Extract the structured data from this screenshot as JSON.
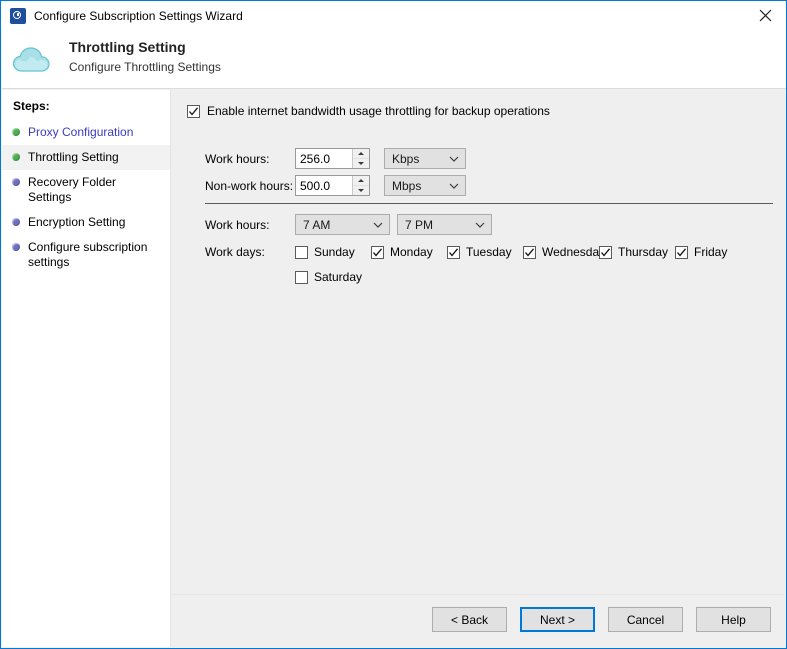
{
  "window": {
    "title": "Configure Subscription Settings Wizard",
    "app_icon": "clock-icon",
    "close_icon": "close-icon"
  },
  "header": {
    "icon": "cloud-icon",
    "title": "Throttling Setting",
    "subtitle": "Configure Throttling Settings"
  },
  "sidebar": {
    "label": "Steps:",
    "items": [
      {
        "label": "Proxy Configuration",
        "state": "done",
        "link": true,
        "active": false
      },
      {
        "label": "Throttling Setting",
        "state": "done",
        "link": false,
        "active": true
      },
      {
        "label": "Recovery Folder Settings",
        "state": "pending",
        "link": false,
        "active": false
      },
      {
        "label": "Encryption Setting",
        "state": "pending",
        "link": false,
        "active": false
      },
      {
        "label": "Configure subscription settings",
        "state": "pending",
        "link": false,
        "active": false
      }
    ]
  },
  "main": {
    "enable_throttling": {
      "label": "Enable internet bandwidth usage throttling for backup operations",
      "checked": true
    },
    "bandwidth": [
      {
        "label": "Work hours:",
        "value": "256.0",
        "unit": "Kbps"
      },
      {
        "label": "Non-work hours:",
        "value": "500.0",
        "unit": "Mbps"
      }
    ],
    "work_hours": {
      "label": "Work hours:",
      "start": "7 AM",
      "end": "7 PM"
    },
    "work_days": {
      "label": "Work days:",
      "days": [
        {
          "label": "Sunday",
          "checked": false
        },
        {
          "label": "Monday",
          "checked": true
        },
        {
          "label": "Tuesday",
          "checked": true
        },
        {
          "label": "Wednesday",
          "checked": true
        },
        {
          "label": "Thursday",
          "checked": true
        },
        {
          "label": "Friday",
          "checked": true
        },
        {
          "label": "Saturday",
          "checked": false
        }
      ]
    }
  },
  "footer": {
    "buttons": [
      {
        "label": "< Back",
        "default": false
      },
      {
        "label": "Next >",
        "default": true
      },
      {
        "label": "Cancel",
        "default": false
      },
      {
        "label": "Help",
        "default": false
      }
    ]
  },
  "colors": {
    "accent": "#0078d7",
    "step_done": "#4caf50",
    "step_pending": "#6f6fc4",
    "link": "#3b3bbf",
    "panel": "#efefef"
  }
}
